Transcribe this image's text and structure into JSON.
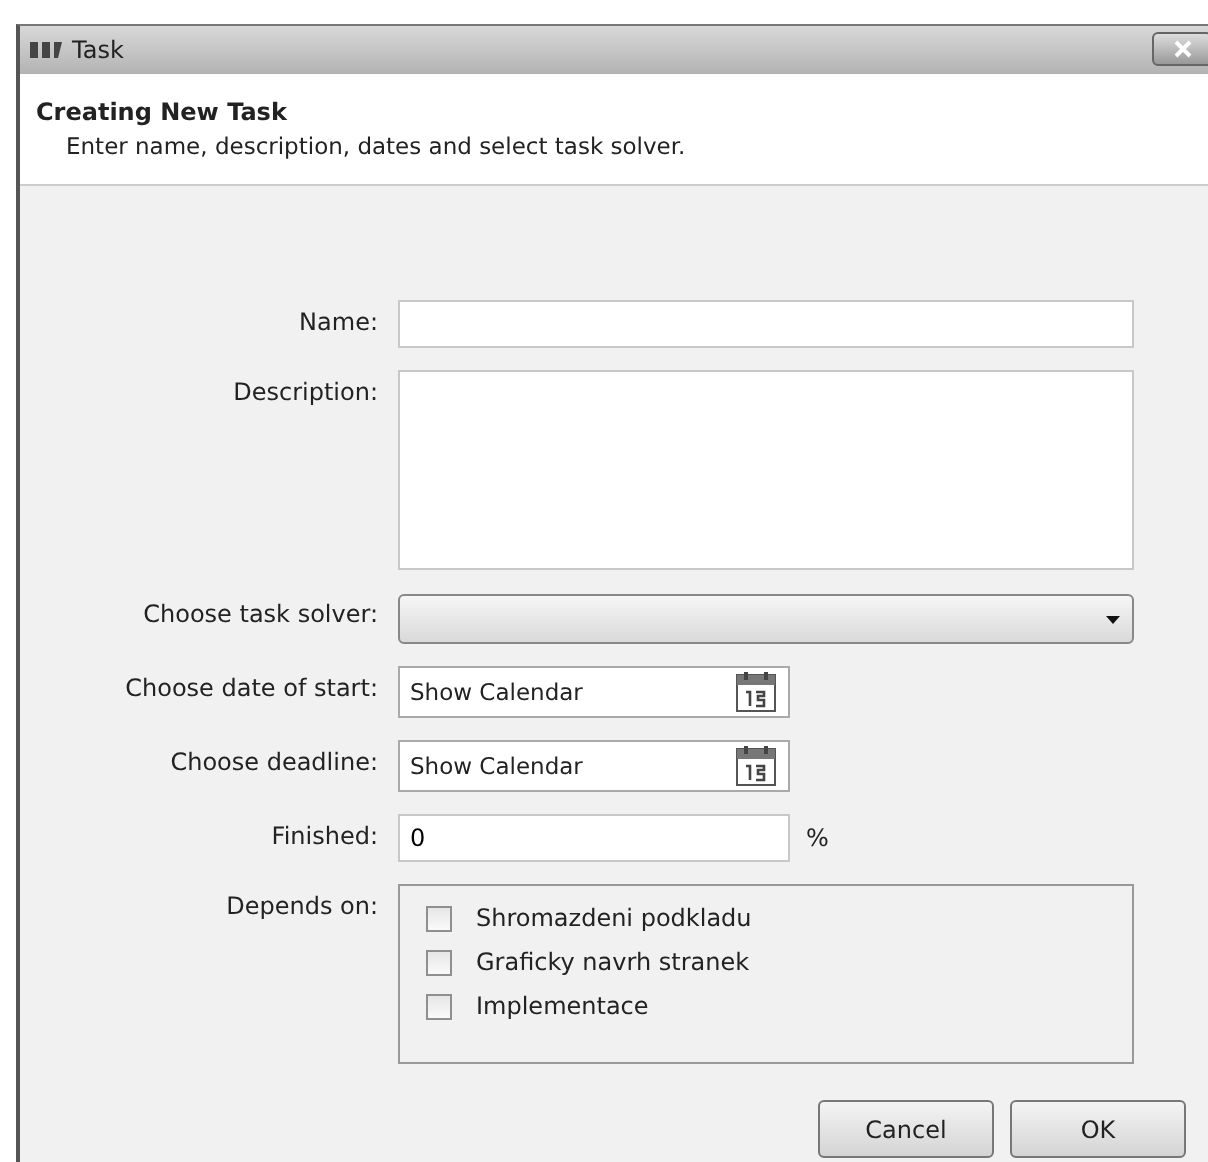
{
  "window": {
    "title": "Task"
  },
  "header": {
    "title": "Creating New Task",
    "subtitle": "Enter name, description, dates and select task solver."
  },
  "fields": [
    {
      "kind": "text",
      "label": "Name:"
    },
    {
      "kind": "textarea",
      "label": "Description:"
    },
    {
      "kind": "dropdown",
      "label": "Choose task solver:"
    },
    {
      "kind": "date",
      "label": "Choose date of start:",
      "value": "Show Calendar"
    },
    {
      "kind": "date",
      "label": "Choose deadline:",
      "value": "Show Calendar"
    },
    {
      "kind": "percent",
      "label": "Finished:",
      "value": "0",
      "unit": "%"
    }
  ],
  "depends_on": {
    "label": "Depends on:",
    "items": [
      {
        "label": "Shromazdeni podkladu",
        "checked": false
      },
      {
        "label": "Graficky navrh stranek",
        "checked": false
      },
      {
        "label": "Implementace",
        "checked": false
      }
    ]
  },
  "buttons": [
    "Cancel",
    "OK"
  ]
}
